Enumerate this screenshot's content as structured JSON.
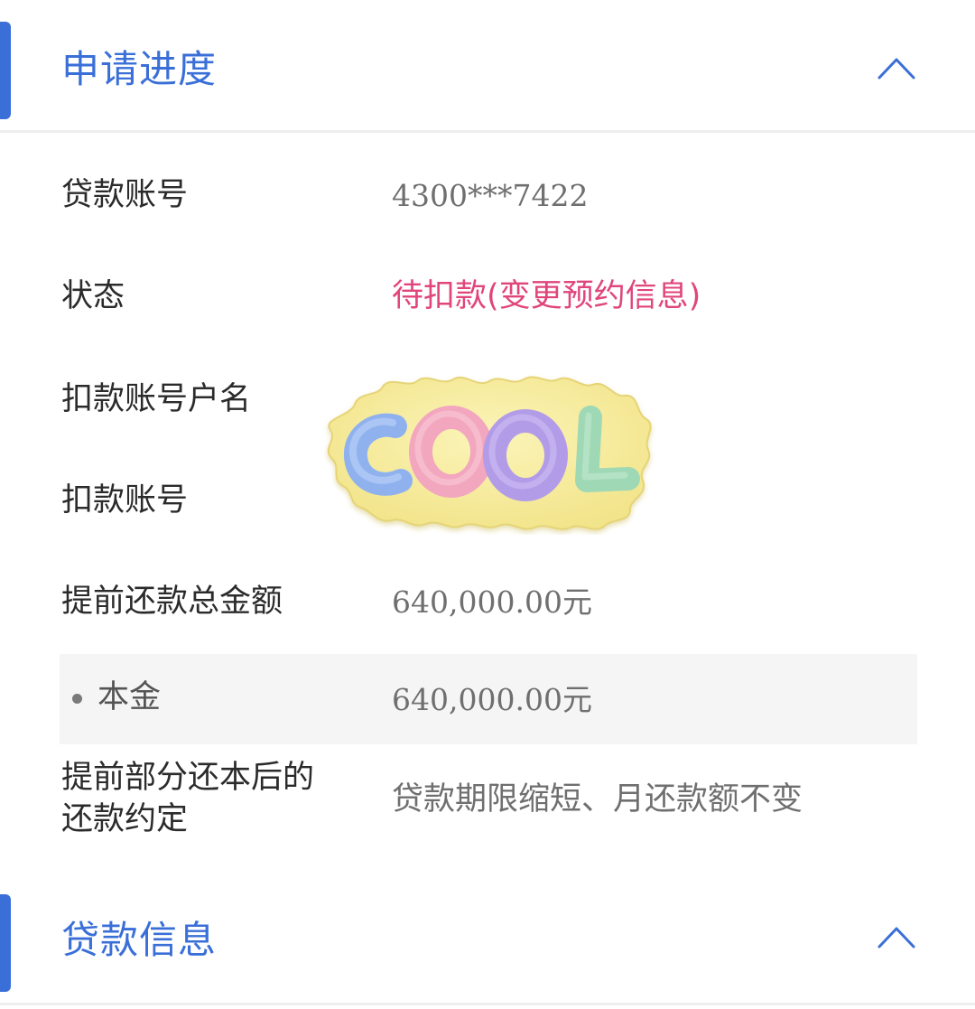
{
  "sections": {
    "progress": {
      "title": "申请进度",
      "expanded": true
    },
    "loan_info": {
      "title": "贷款信息",
      "expanded": true
    }
  },
  "fields": {
    "loan_account": {
      "label": "贷款账号",
      "value": "4300***7422"
    },
    "status": {
      "label": "状态",
      "value": "待扣款(变更预约信息)",
      "color": "#e0467c"
    },
    "debit_account_name": {
      "label": "扣款账号户名",
      "value": ""
    },
    "debit_account": {
      "label": "扣款账号",
      "value": ""
    },
    "prepay_total": {
      "label": "提前还款总金额",
      "value": "640,000.00元"
    },
    "principal": {
      "label": "本金",
      "value": "640,000.00元"
    },
    "repay_agreement": {
      "label_line1": "提前部分还本后的",
      "label_line2": "还款约定",
      "value": "贷款期限缩短、月还款额不变"
    }
  },
  "sticker": {
    "text": "COOL",
    "letter_colors": [
      "#8fb2ef",
      "#f2a7bf",
      "#b29ce8",
      "#9fd8b5"
    ],
    "background_color": "#f7ec9e"
  },
  "colors": {
    "accent": "#3a6fd8",
    "status": "#e0467c",
    "label": "#2b2b2b",
    "value": "#6f6f6f"
  }
}
